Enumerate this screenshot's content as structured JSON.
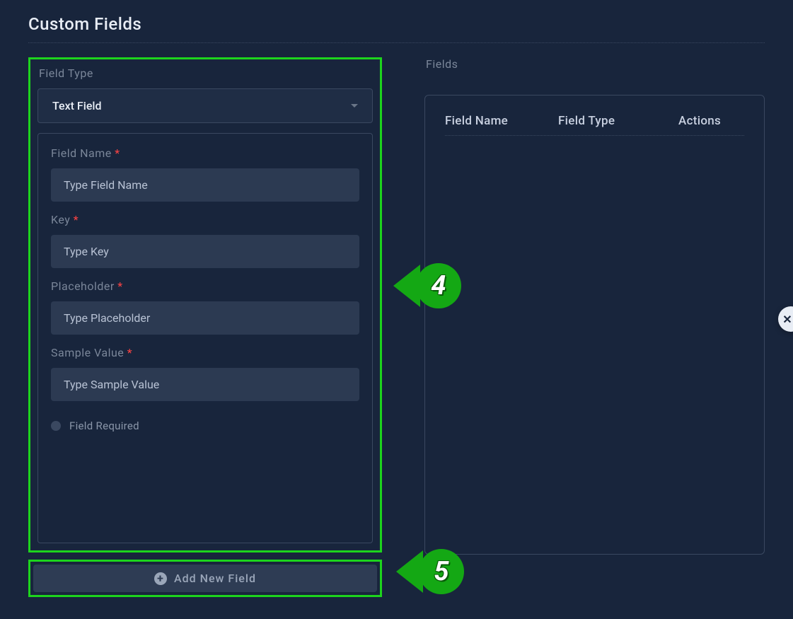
{
  "page": {
    "title": "Custom Fields"
  },
  "fieldType": {
    "label": "Field Type",
    "selected": "Text Field"
  },
  "form": {
    "fieldName": {
      "label": "Field Name",
      "placeholder": "Type Field Name",
      "required": "*"
    },
    "key": {
      "label": "Key",
      "placeholder": "Type Key",
      "required": "*"
    },
    "placeholder": {
      "label": "Placeholder",
      "placeholder": "Type Placeholder",
      "required": "*"
    },
    "sampleValue": {
      "label": "Sample Value",
      "placeholder": "Type Sample Value",
      "required": "*"
    },
    "fieldRequired": {
      "label": "Field Required"
    }
  },
  "addButton": {
    "label": "Add New Field"
  },
  "fieldsTable": {
    "heading": "Fields",
    "columns": {
      "name": "Field Name",
      "type": "Field Type",
      "actions": "Actions"
    }
  },
  "callouts": {
    "c4": "4",
    "c5": "5"
  }
}
